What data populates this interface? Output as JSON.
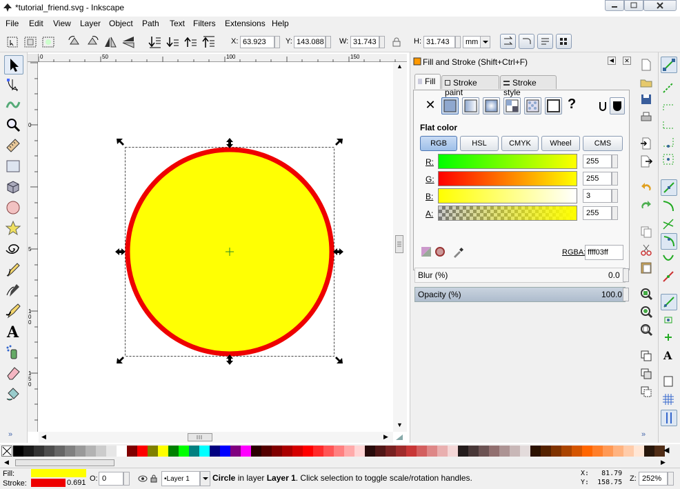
{
  "window": {
    "title": "*tutorial_friend.svg - Inkscape"
  },
  "menubar": [
    "File",
    "Edit",
    "View",
    "Layer",
    "Object",
    "Path",
    "Text",
    "Filters",
    "Extensions",
    "Help"
  ],
  "toolbar": {
    "x_label": "X:",
    "x_value": "63.923",
    "y_label": "Y:",
    "y_value": "143.088",
    "w_label": "W:",
    "w_value": "31.743",
    "h_label": "H:",
    "h_value": "31.743",
    "unit": "mm"
  },
  "tools": [
    "selector-tool",
    "node-tool",
    "tweak-tool",
    "zoom-tool",
    "measure-tool",
    "rectangle-tool",
    "box3d-tool",
    "ellipse-tool",
    "star-tool",
    "spiral-tool",
    "pencil-tool",
    "pen-tool",
    "calligraphy-tool",
    "text-tool",
    "spray-tool",
    "eraser-tool",
    "paint-bucket-tool"
  ],
  "rulers": {
    "top_ticks": [
      "0",
      "50",
      "100",
      "150"
    ],
    "left_ticks": [
      "0",
      "5",
      "100",
      "150"
    ]
  },
  "canvas": {
    "circle_fill": "#ffff03",
    "circle_stroke": "#ee0000",
    "selection_marker": "#2a8a2a"
  },
  "dialog": {
    "title": "Fill and Stroke (Shift+Ctrl+F)",
    "tabs": [
      "Fill",
      "Stroke paint",
      "Stroke style"
    ],
    "active_tab": "Fill",
    "paint_types": [
      "no-paint",
      "flat-color",
      "linear-gradient",
      "radial-gradient",
      "mesh-gradient",
      "pattern",
      "swatch",
      "unset"
    ],
    "unset_label": "?",
    "section_label": "Flat color",
    "modes": [
      "RGB",
      "HSL",
      "CMYK",
      "Wheel",
      "CMS"
    ],
    "active_mode": "RGB",
    "channels": [
      {
        "label": "R:",
        "value": "255"
      },
      {
        "label": "G:",
        "value": "255"
      },
      {
        "label": "B:",
        "value": "3"
      },
      {
        "label": "A:",
        "value": "255"
      }
    ],
    "rgba_label": "RGBA:",
    "rgba_value": "ffff03ff",
    "blur_label": "Blur (%)",
    "blur_value": "0.0",
    "opacity_label": "Opacity (%)",
    "opacity_value": "100.0"
  },
  "palette_colors": [
    "#000000",
    "#1a1a1a",
    "#333333",
    "#4d4d4d",
    "#666666",
    "#808080",
    "#999999",
    "#b3b3b3",
    "#cccccc",
    "#e6e6e6",
    "#ffffff",
    "#800000",
    "#ff0000",
    "#808000",
    "#ffff00",
    "#008000",
    "#00ff00",
    "#008080",
    "#00ffff",
    "#000080",
    "#0000ff",
    "#800080",
    "#ff00ff",
    "#2b0000",
    "#550000",
    "#800000",
    "#aa0000",
    "#d40000",
    "#ff0000",
    "#ff2a2a",
    "#ff5555",
    "#ff8080",
    "#ffaaaa",
    "#ffd5d5",
    "#280b0b",
    "#501616",
    "#782121",
    "#a02c2c",
    "#c83737",
    "#d35f5f",
    "#de8787",
    "#e9afaf",
    "#f4d7d7",
    "#241c1c",
    "#483737",
    "#6c5353",
    "#916f6f",
    "#ac9393",
    "#c8b7b7",
    "#e3dbdb",
    "#2b1100",
    "#552200",
    "#803300",
    "#aa4400",
    "#d45500",
    "#ff6600",
    "#ff7f2a",
    "#ff9955",
    "#ffb380",
    "#ffccaa",
    "#ffe6d5",
    "#28170b",
    "#502d16"
  ],
  "status": {
    "fill_label": "Fill:",
    "stroke_label": "Stroke:",
    "fill_color": "#ffff00",
    "stroke_color": "#ee0000",
    "stroke_width": "0.691",
    "opacity_label": "O:",
    "opacity_value": "0",
    "layer": "•Layer 1",
    "message_obj": "Circle",
    "message_mid": " in layer ",
    "message_layer": "Layer 1",
    "message_rest": ". Click selection to toggle scale/rotation handles.",
    "x_coord": "X:   81.79",
    "y_coord": "Y:  158.75",
    "zoom_label": "Z:",
    "zoom_value": "252%"
  }
}
